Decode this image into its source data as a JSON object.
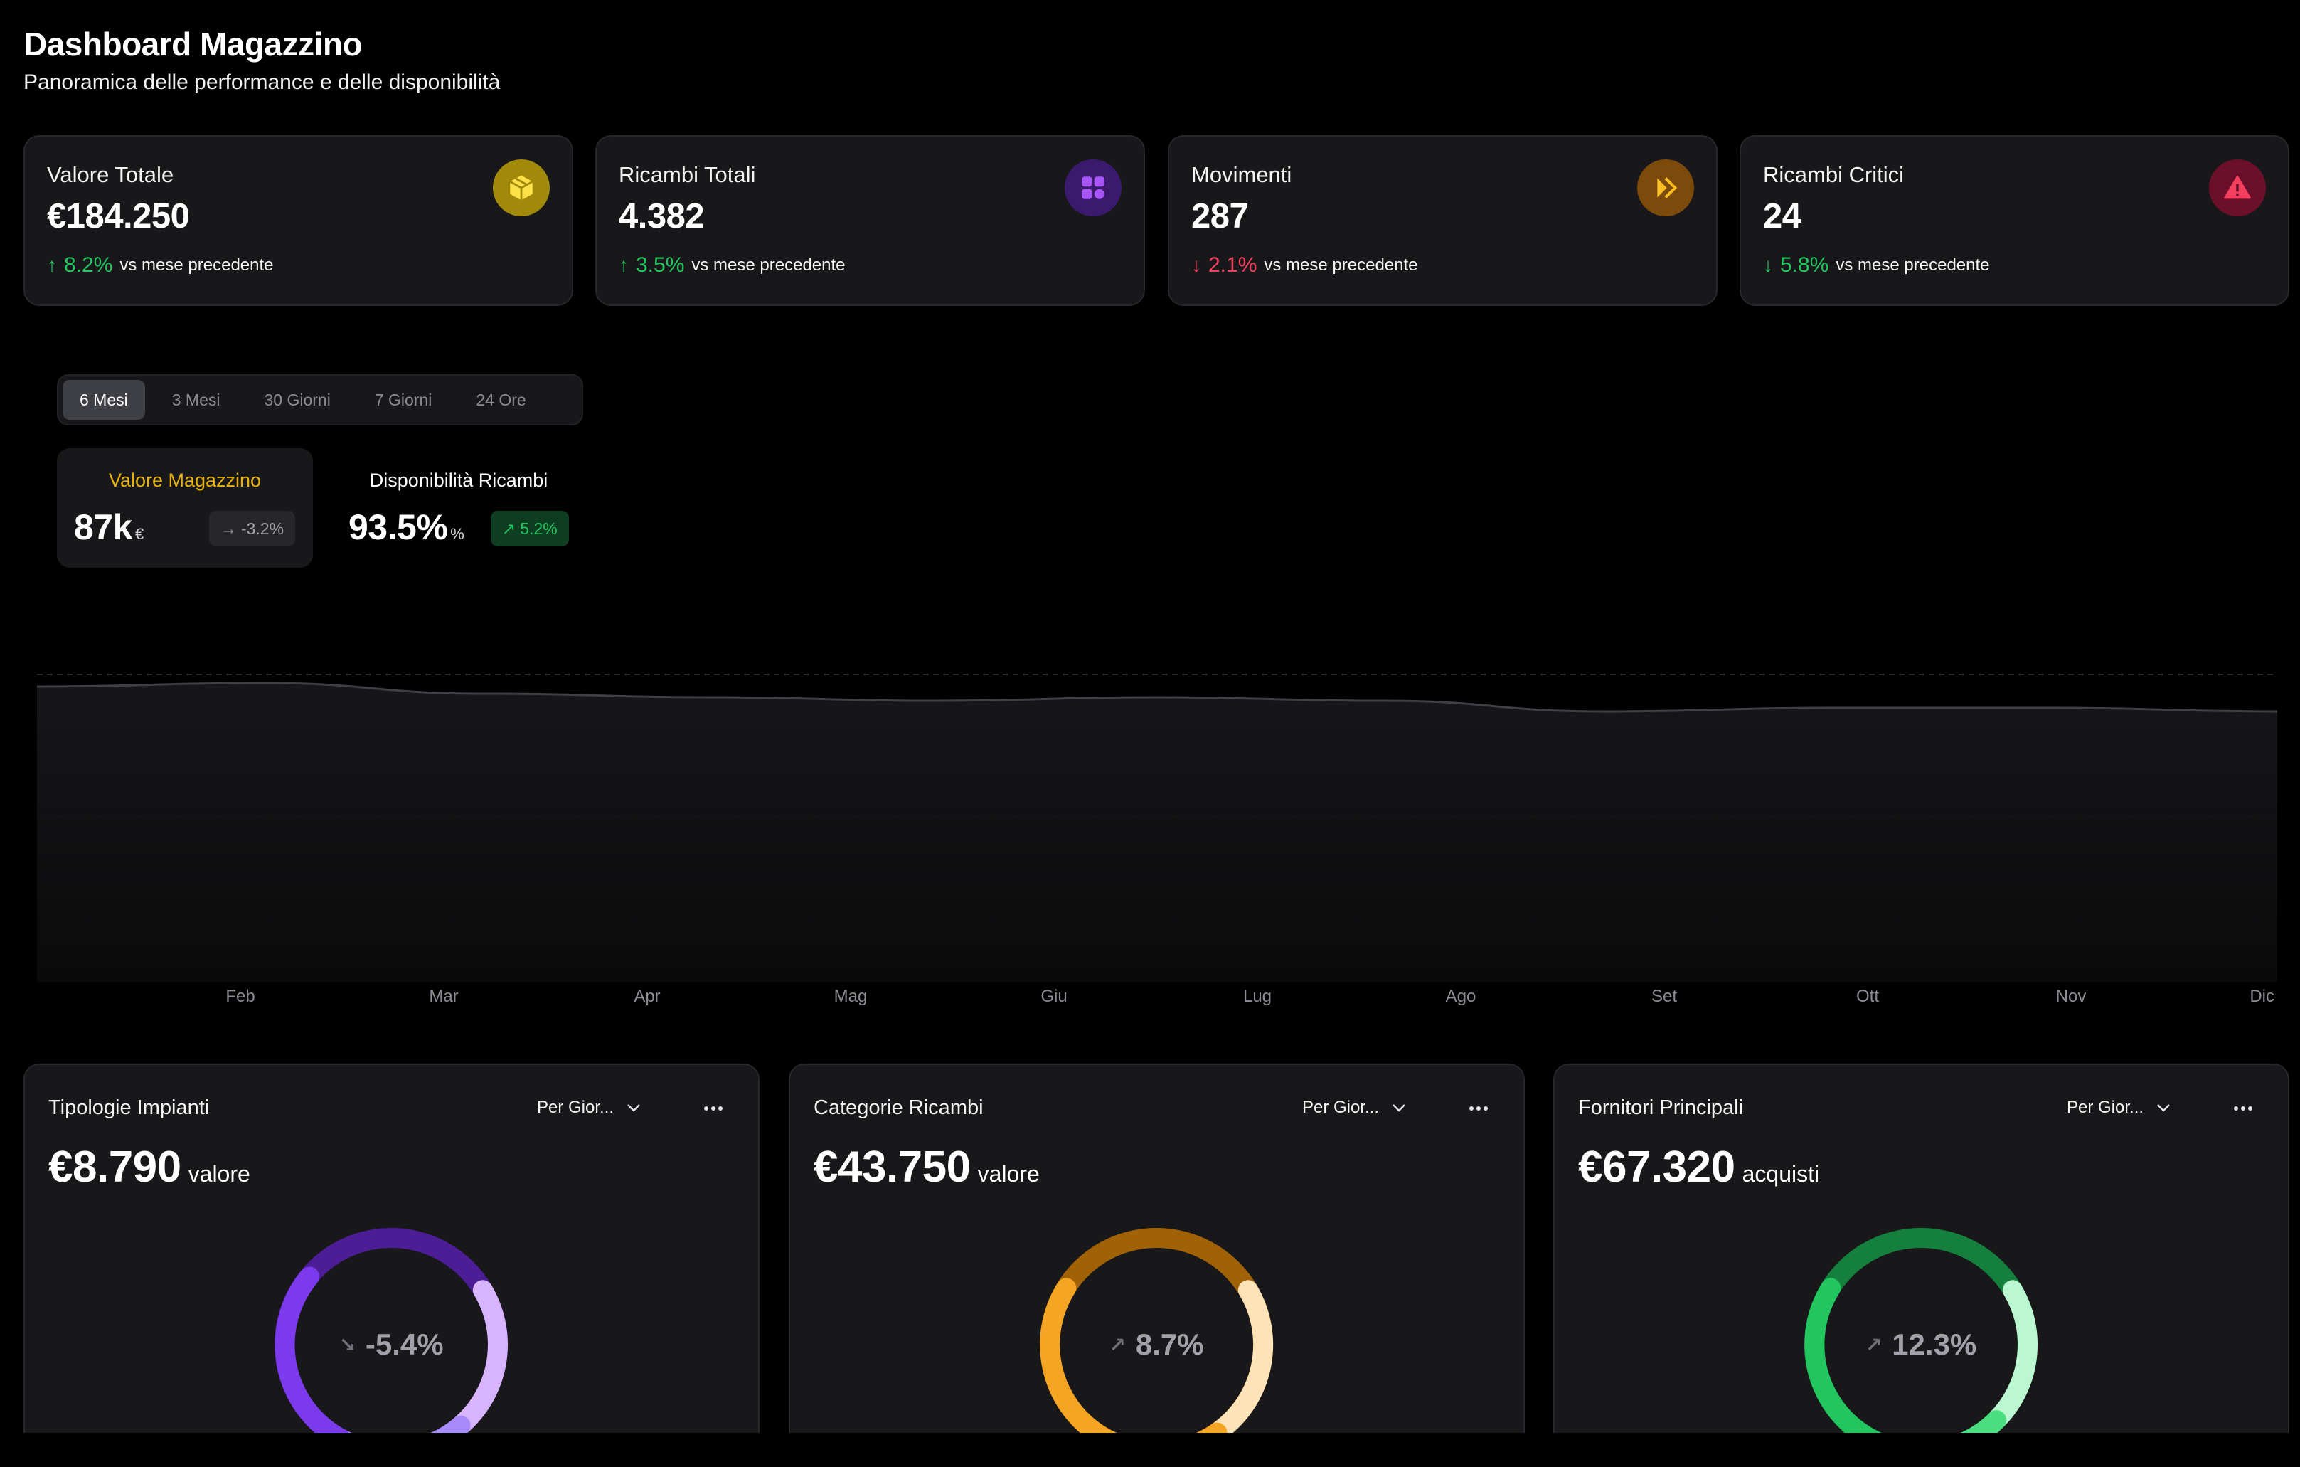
{
  "header": {
    "title": "Dashboard Magazzino",
    "subtitle": "Panoramica delle performance e delle disponibilità"
  },
  "stats": [
    {
      "label": "Valore Totale",
      "value": "€184.250",
      "arrow": "↑",
      "change": "8.2%",
      "trend": "positive",
      "note": "vs mese precedente",
      "icon": "package-icon",
      "icon_color": "#eab308"
    },
    {
      "label": "Ricambi Totali",
      "value": "4.382",
      "arrow": "↑",
      "change": "3.5%",
      "trend": "positive",
      "note": "vs mese precedente",
      "icon": "grid-icon",
      "icon_color": "#7c3aed"
    },
    {
      "label": "Movimenti",
      "value": "287",
      "arrow": "↓",
      "change": "2.1%",
      "trend": "negative",
      "note": "vs mese precedente",
      "icon": "fast-forward-icon",
      "icon_color": "#f59e0b"
    },
    {
      "label": "Ricambi Critici",
      "value": "24",
      "arrow": "↓",
      "change": "5.8%",
      "trend": "positive",
      "note": "vs mese precedente",
      "icon": "alert-triangle-icon",
      "icon_color": "#f43f5e"
    }
  ],
  "range_tabs": {
    "items": [
      "6 Mesi",
      "3 Mesi",
      "30 Giorni",
      "7 Giorni",
      "24 Ore"
    ],
    "selected": "6 Mesi"
  },
  "metrics": [
    {
      "title": "Valore Magazzino",
      "value": "87k",
      "unit": "€",
      "badge": "-3.2%",
      "badge_icon": "→",
      "selected": true,
      "title_color": "#eab308"
    },
    {
      "title": "Disponibilità Ricambi",
      "value": "93.5%",
      "unit": "%",
      "badge": "5.2%",
      "badge_icon": "↗",
      "selected": false
    }
  ],
  "chart_data": {
    "type": "area",
    "categories": [
      "Feb",
      "Mar",
      "Apr",
      "Mag",
      "Giu",
      "Lug",
      "Ago",
      "Set",
      "Ott",
      "Nov",
      "Dic"
    ],
    "series": [
      {
        "values": [
          91,
          92,
          89,
          88,
          87,
          88,
          87,
          84,
          85,
          85,
          84
        ]
      }
    ],
    "grid": true,
    "gridline_style": "dashed"
  },
  "panels": [
    {
      "title": "Tipologie Impianti",
      "select": "Per Gior...",
      "value": "€8.790",
      "suffix": "valore",
      "change": "-5.4%",
      "change_icon": "↘",
      "palette": "purple"
    },
    {
      "title": "Categorie Ricambi",
      "select": "Per Gior...",
      "value": "€43.750",
      "suffix": "valore",
      "change": "8.7%",
      "change_icon": "↗",
      "palette": "orange"
    },
    {
      "title": "Fornitori Principali",
      "select": "Per Gior...",
      "value": "€67.320",
      "suffix": "acquisti",
      "change": "12.3%",
      "change_icon": "↗",
      "palette": "green"
    }
  ]
}
